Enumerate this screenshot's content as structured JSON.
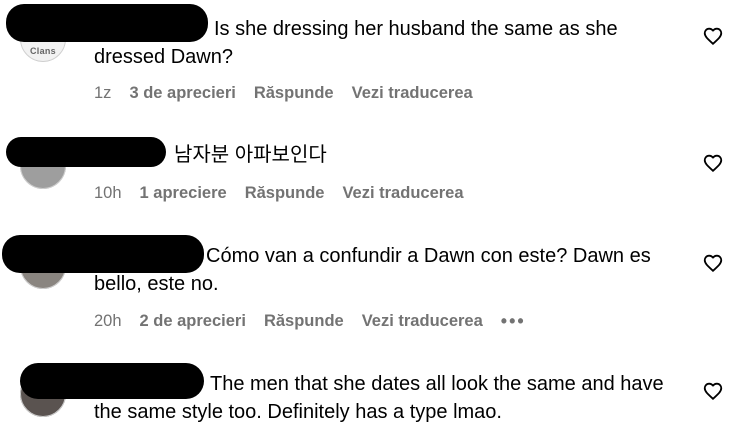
{
  "comments": [
    {
      "avatar_text": "Clans",
      "text_lines": [
        "Is she dressing her husband the same as she",
        "dressed Dawn?"
      ],
      "time": "1z",
      "likes": "3 de aprecieri",
      "reply_label": "Răspunde",
      "translate_label": "Vezi traducerea"
    },
    {
      "avatar_text": "",
      "text_lines": [
        "남자분 아파보인다"
      ],
      "time": "10h",
      "likes": "1 apreciere",
      "reply_label": "Răspunde",
      "translate_label": "Vezi traducerea"
    },
    {
      "avatar_text": "",
      "text_lines": [
        "Cómo van a confundir a Dawn con este? Dawn es",
        "bello, este no."
      ],
      "time": "20h",
      "likes": "2 de aprecieri",
      "reply_label": "Răspunde",
      "translate_label": "Vezi traducerea",
      "more_label": "•••"
    },
    {
      "avatar_text": "",
      "text_lines": [
        "The men that she dates all look the same and have",
        "the same style too. Definitely has a type lmao."
      ],
      "time": "",
      "likes": "",
      "reply_label": "",
      "translate_label": ""
    }
  ],
  "icons": {
    "like": "heart-outline-icon",
    "more": "more-horizontal-icon"
  },
  "colors": {
    "meta": "#737373",
    "text": "#000000",
    "redaction": "#000000"
  }
}
